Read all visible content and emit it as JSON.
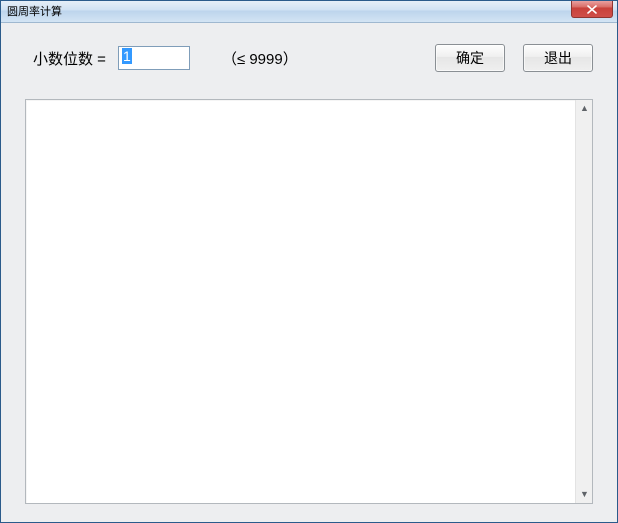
{
  "window": {
    "title": "圆周率计算"
  },
  "form": {
    "digits_label": "小数位数  =",
    "digits_value": "1",
    "hint": "（≤ 9999）"
  },
  "buttons": {
    "ok": "确定",
    "exit": "退出"
  },
  "output": {
    "text": ""
  }
}
